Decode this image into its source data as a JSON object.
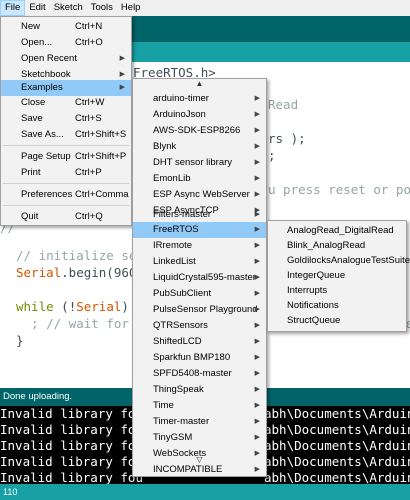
{
  "menubar": {
    "items": [
      "File",
      "Edit",
      "Sketch",
      "Tools",
      "Help"
    ]
  },
  "file_menu": {
    "items": [
      {
        "label": "New",
        "shortcut": "Ctrl+N"
      },
      {
        "label": "Open...",
        "shortcut": "Ctrl+O"
      },
      {
        "label": "Open Recent",
        "shortcut": ""
      },
      {
        "label": "Sketchbook",
        "shortcut": ""
      },
      {
        "label": "Examples",
        "shortcut": ""
      },
      {
        "label": "Close",
        "shortcut": "Ctrl+W"
      },
      {
        "label": "Save",
        "shortcut": "Ctrl+S"
      },
      {
        "label": "Save As...",
        "shortcut": "Ctrl+Shift+S"
      },
      {
        "label": "Page Setup",
        "shortcut": "Ctrl+Shift+P"
      },
      {
        "label": "Print",
        "shortcut": "Ctrl+P"
      },
      {
        "label": "Preferences",
        "shortcut": "Ctrl+Comma"
      },
      {
        "label": "Quit",
        "shortcut": "Ctrl+Q"
      }
    ]
  },
  "examples_menu": {
    "scroll_up": "▲",
    "scroll_down": "▽",
    "items": [
      "arduino-timer",
      "ArduinoJson",
      "AWS-SDK-ESP8266",
      "Blynk",
      "DHT sensor library",
      "EmonLib",
      "ESP Async WebServer",
      "ESP AsyncTCP",
      "Filters-master",
      "FreeRTOS",
      "IRremote",
      "LinkedList",
      "LiquidCrystal595-master",
      "PubSubClient",
      "PulseSensor Playground",
      "QTRSensors",
      "ShiftedLCD",
      "Sparkfun BMP180",
      "SPFD5408-master",
      "ThingSpeak",
      "Time",
      "Timer-master",
      "TinyGSM",
      "WebSockets",
      "INCOMPATIBLE"
    ]
  },
  "freertos_menu": {
    "items": [
      "AnalogRead_DigitalRead",
      "Blink_AnalogRead",
      "GoldilocksAnalogueTestSuite",
      "IntegerQueue",
      "Interrupts",
      "Notifications",
      "StructQueue"
    ]
  },
  "editor": {
    "l1": "FreeRTOS.h>",
    "l2": "Read",
    "l3": "rs );",
    "l4": ";",
    "l5": "u press reset or pow",
    "l6": "// initialize se",
    "l7a": "Serial",
    "l7b": ".begin(960",
    "l8a": "while",
    "l8b": " (!",
    "l8c": "Serial",
    "l8d": ")",
    "l9": "  ; // wait for",
    "l9r": "ve",
    "l10": "}",
    "l11": "//"
  },
  "status": {
    "text": "Done uploading."
  },
  "console": {
    "lines": [
      {
        "left": "Invalid library fou",
        "right": "abh\\Documents\\Arduinc"
      },
      {
        "left": "Invalid library fou",
        "right": "abh\\Documents\\Arduinc"
      },
      {
        "left": "Invalid library fou",
        "right": "abh\\Documents\\Arduinc"
      },
      {
        "left": "Invalid library fou",
        "right": "abh\\Documents\\Arduinc"
      },
      {
        "left": "Invalid library fou",
        "right": "abh\\Documents\\Arduinc"
      }
    ]
  },
  "bottombar": {
    "text": "110"
  },
  "colors": {
    "teal_dark": "#006468",
    "teal_light": "#17a1a5",
    "highlight": "#91c9f7"
  }
}
